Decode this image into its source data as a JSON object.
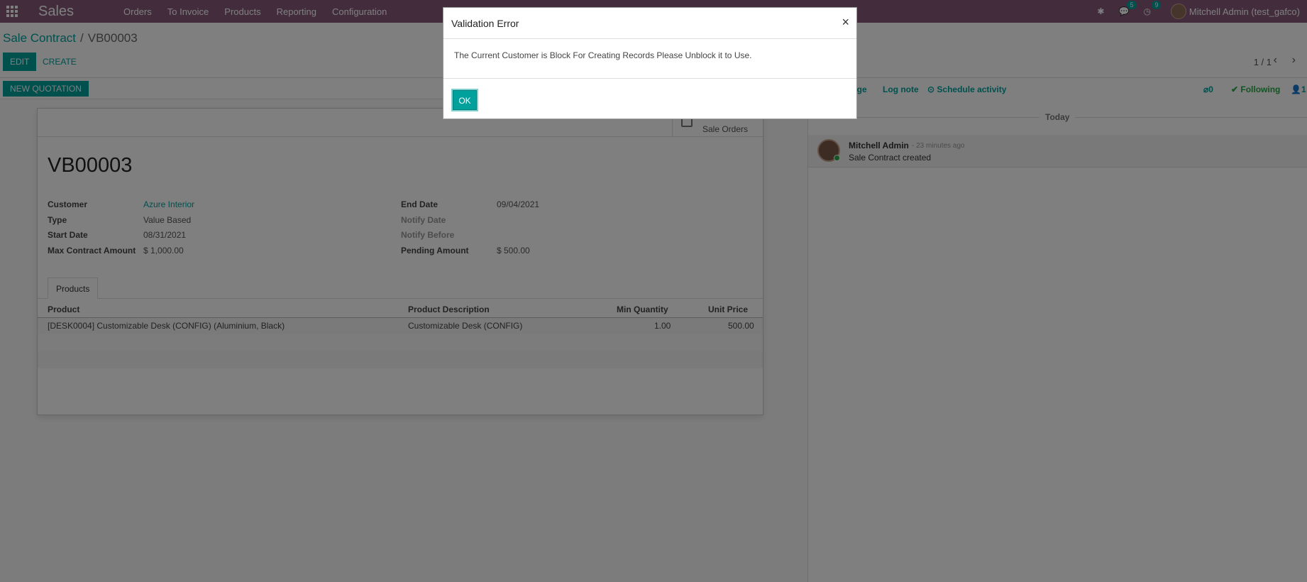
{
  "navbar": {
    "brand": "Sales",
    "menu": [
      "Orders",
      "To Invoice",
      "Products",
      "Reporting",
      "Configuration"
    ],
    "messages_count": "5",
    "activities_count": "9",
    "user": "Mitchell Admin (test_gafco)"
  },
  "breadcrumb": {
    "parent": "Sale Contract",
    "separator": "/",
    "current": "VB00003"
  },
  "toolbar": {
    "edit": "EDIT",
    "create": "CREATE",
    "pager": "1 / 1"
  },
  "status": {
    "new_quotation": "NEW QUOTATION"
  },
  "form": {
    "smart_button": "Sale Orders",
    "title": "VB00003",
    "fields": {
      "customer_label": "Customer",
      "customer": "Azure Interior",
      "type_label": "Type",
      "type": "Value Based",
      "start_label": "Start Date",
      "start": "08/31/2021",
      "max_label": "Max Contract Amount",
      "max": "$ 1,000.00",
      "end_label": "End Date",
      "end": "09/04/2021",
      "notify_date_label": "Notify Date",
      "notify_before_label": "Notify Before",
      "pending_label": "Pending Amount",
      "pending": "$ 500.00"
    },
    "tab": "Products",
    "columns": [
      "Product",
      "Product Description",
      "Min Quantity",
      "Unit Price"
    ],
    "rows": [
      {
        "product": "[DESK0004] Customizable Desk (CONFIG) (Aluminium, Black)",
        "description": "Customizable Desk (CONFIG)",
        "min_qty": "1.00",
        "unit_price": "500.00"
      }
    ]
  },
  "chatter": {
    "send_message": "age",
    "log_note": "Log note",
    "schedule": "Schedule activity",
    "attachments": "0",
    "following": "Following",
    "followers": "1",
    "today": "Today",
    "message": {
      "author": "Mitchell Admin",
      "time": "- 23 minutes ago",
      "body": "Sale Contract created"
    }
  },
  "modal": {
    "title": "Validation Error",
    "close": "×",
    "message": "The Current Customer is Block For Creating Records Please Unblock it to Use.",
    "ok": "OK"
  }
}
